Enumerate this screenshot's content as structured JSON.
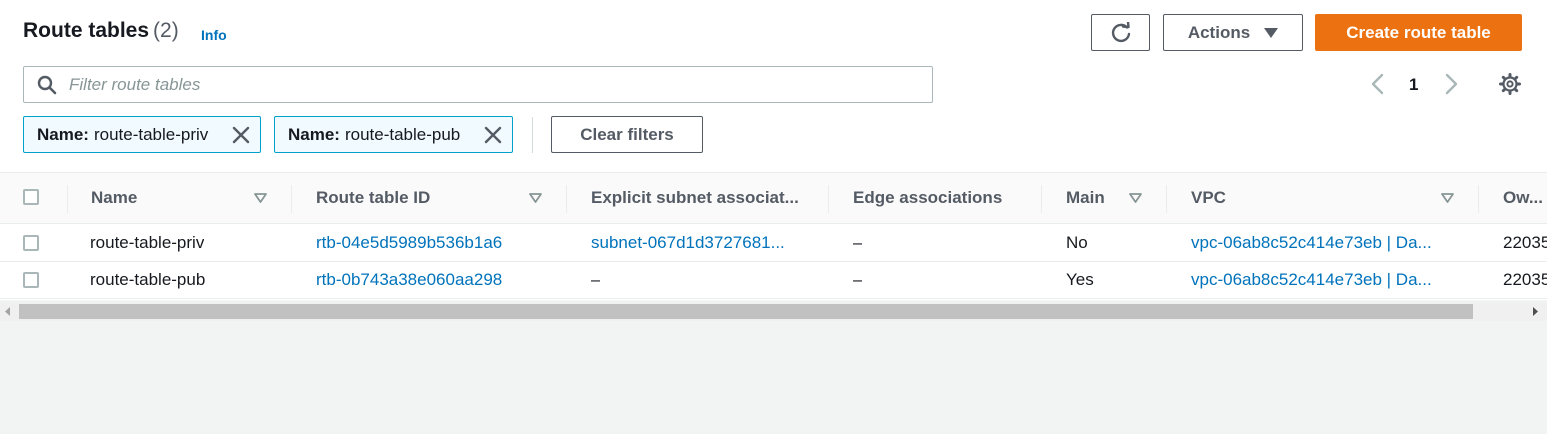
{
  "header": {
    "title": "Route tables",
    "count": "(2)",
    "info_label": "Info"
  },
  "toolbar": {
    "actions_label": "Actions",
    "create_label": "Create route table"
  },
  "search": {
    "placeholder": "Filter route tables",
    "value": ""
  },
  "pagination": {
    "current_page": "1"
  },
  "filters": [
    {
      "key": "Name:",
      "value": "route-table-priv"
    },
    {
      "key": "Name:",
      "value": "route-table-pub"
    }
  ],
  "clear_filters_label": "Clear filters",
  "table": {
    "columns": [
      {
        "label": "Name",
        "sortable": true
      },
      {
        "label": "Route table ID",
        "sortable": true
      },
      {
        "label": "Explicit subnet associat...",
        "sortable": false
      },
      {
        "label": "Edge associations",
        "sortable": false
      },
      {
        "label": "Main",
        "sortable": true
      },
      {
        "label": "VPC",
        "sortable": true
      },
      {
        "label": "Ow...",
        "sortable": false
      }
    ],
    "rows": [
      {
        "name": "route-table-priv",
        "route_table_id": "rtb-04e5d5989b536b1a6",
        "explicit_subnet": "subnet-067d1d3727681...",
        "edge": "–",
        "main": "No",
        "vpc": "vpc-06ab8c52c414e73eb | Da...",
        "owner": "22035"
      },
      {
        "name": "route-table-pub",
        "route_table_id": "rtb-0b743a38e060aa298",
        "explicit_subnet": "–",
        "edge": "–",
        "main": "Yes",
        "vpc": "vpc-06ab8c52c414e73eb | Da...",
        "owner": "22035"
      }
    ]
  },
  "colors": {
    "accent": "#ec7211",
    "link": "#0073bb",
    "token_border": "#00a1c9"
  }
}
